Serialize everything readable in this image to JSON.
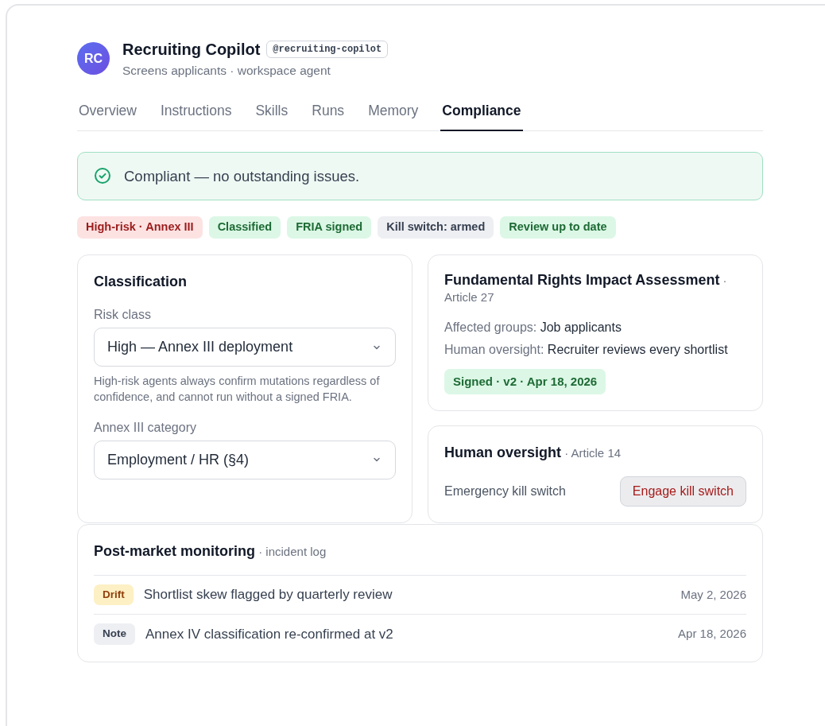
{
  "agent": {
    "initials": "RC",
    "name": "Recruiting Copilot",
    "handle": "@recruiting-copilot",
    "subtitle": "Screens applicants · workspace agent"
  },
  "tabs": [
    {
      "label": "Overview",
      "selected": false
    },
    {
      "label": "Instructions",
      "selected": false
    },
    {
      "label": "Skills",
      "selected": false
    },
    {
      "label": "Runs",
      "selected": false
    },
    {
      "label": "Memory",
      "selected": false
    },
    {
      "label": "Compliance",
      "selected": true
    }
  ],
  "status_banner": {
    "kind": "success",
    "text": "Compliant — no outstanding issues."
  },
  "tags": [
    {
      "label": "High-risk · Annex III",
      "kind": "danger"
    },
    {
      "label": "Classified",
      "kind": "success"
    },
    {
      "label": "FRIA signed",
      "kind": "success"
    },
    {
      "label": "Kill switch: armed",
      "kind": "neutral"
    },
    {
      "label": "Review up to date",
      "kind": "success"
    }
  ],
  "classification": {
    "title": "Classification",
    "risk_label": "Risk class",
    "risk_value": "High — Annex III deployment",
    "help": "High-risk agents always confirm mutations regardless of confidence, and cannot run without a signed FRIA.",
    "category_label": "Annex III category",
    "category_value": "Employment / HR (§4)"
  },
  "fria": {
    "title": "Fundamental Rights Impact Assessment",
    "ref": "· Article 27",
    "facts": [
      {
        "label": "Affected groups:",
        "value": "Job applicants"
      },
      {
        "label": "Human oversight:",
        "value": "Recruiter reviews every shortlist"
      }
    ],
    "status": "Signed · v2 · Apr 18, 2026"
  },
  "oversight": {
    "title": "Human oversight",
    "ref": "· Article 14",
    "label": "Emergency kill switch",
    "button": "Engage kill switch"
  },
  "monitoring": {
    "title": "Post-market monitoring",
    "ref": "· incident log",
    "incidents": [
      {
        "kind": "drift",
        "tag": "Drift",
        "text": "Shortlist skew flagged by quarterly review",
        "date": "May 2, 2026"
      },
      {
        "kind": "note",
        "tag": "Note",
        "text": "Annex IV classification re-confirmed at v2",
        "date": "Apr 18, 2026"
      }
    ]
  }
}
